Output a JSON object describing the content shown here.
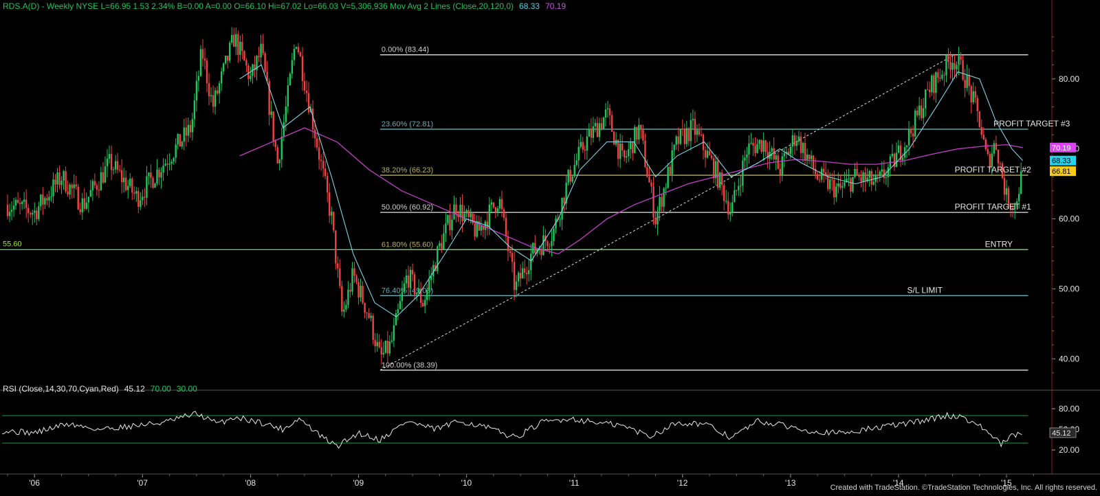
{
  "header": {
    "segments": [
      {
        "text": "RDS.A(D) - Weekly  NYSE  L=66.95  1.53  2.34%  B=0.00  A=0.00  O=66.10  Hi=67.02  Lo=66.03  V=5,306,936  Mov Avg 2 Lines (Close,20,120,0)",
        "color": "#22c55e"
      },
      {
        "text": "68.33",
        "color": "#4fd1e8"
      },
      {
        "text": "70.19",
        "color": "#d946ef"
      }
    ]
  },
  "rsi_header": {
    "segments": [
      {
        "text": "RSI (Close,14,30,70,Cyan,Red)",
        "color": "#e5e5e5"
      },
      {
        "text": "45.12",
        "color": "#e5e5e5"
      },
      {
        "text": "70.00",
        "color": "#22c55e"
      },
      {
        "text": "30.00",
        "color": "#22c55e"
      }
    ]
  },
  "footer": "Created with TradeStation. ©TradeStation Technologies, Inc. All rights reserved.",
  "colors": {
    "up": "#22c55e",
    "down": "#ef4444",
    "ma20": "#7fd6e6",
    "ma120": "#c23fc6",
    "fib": "#d0d0d0",
    "fib236": "#5fb0b8",
    "fib382": "#b8b060",
    "entry": "#4ade80",
    "rsi_line": "#e8e8e8",
    "grid_red": "#8b1a1a"
  },
  "chart_data": {
    "type": "candlestick",
    "title": "RDS.A(D) - Weekly NYSE",
    "x_ticks": [
      "'06",
      "'07",
      "'08",
      "'09",
      "'10",
      "'11",
      "'12",
      "'13",
      "'14",
      "'15"
    ],
    "y_ticks": [
      "80.00",
      "70.00",
      "60.00",
      "50.00",
      "40.00"
    ],
    "y_tick_values": [
      80,
      70,
      60,
      50,
      40
    ],
    "ylim": [
      36.6,
      89.5
    ],
    "price_path": [
      {
        "t": 2005.75,
        "v": 62
      },
      {
        "t": 2006.0,
        "v": 61
      },
      {
        "t": 2006.25,
        "v": 66
      },
      {
        "t": 2006.45,
        "v": 62
      },
      {
        "t": 2006.7,
        "v": 68
      },
      {
        "t": 2006.95,
        "v": 63
      },
      {
        "t": 2007.2,
        "v": 68
      },
      {
        "t": 2007.45,
        "v": 73
      },
      {
        "t": 2007.55,
        "v": 84
      },
      {
        "t": 2007.65,
        "v": 76
      },
      {
        "t": 2007.85,
        "v": 86
      },
      {
        "t": 2008.0,
        "v": 80
      },
      {
        "t": 2008.1,
        "v": 84
      },
      {
        "t": 2008.25,
        "v": 68
      },
      {
        "t": 2008.35,
        "v": 78
      },
      {
        "t": 2008.42,
        "v": 86
      },
      {
        "t": 2008.6,
        "v": 72
      },
      {
        "t": 2008.75,
        "v": 60
      },
      {
        "t": 2008.85,
        "v": 46
      },
      {
        "t": 2008.95,
        "v": 52
      },
      {
        "t": 2009.1,
        "v": 46
      },
      {
        "t": 2009.2,
        "v": 40
      },
      {
        "t": 2009.3,
        "v": 42
      },
      {
        "t": 2009.45,
        "v": 52
      },
      {
        "t": 2009.6,
        "v": 48
      },
      {
        "t": 2009.75,
        "v": 56
      },
      {
        "t": 2009.9,
        "v": 62
      },
      {
        "t": 2010.1,
        "v": 58
      },
      {
        "t": 2010.3,
        "v": 63
      },
      {
        "t": 2010.45,
        "v": 50
      },
      {
        "t": 2010.6,
        "v": 55
      },
      {
        "t": 2010.8,
        "v": 58
      },
      {
        "t": 2010.95,
        "v": 66
      },
      {
        "t": 2011.1,
        "v": 71
      },
      {
        "t": 2011.3,
        "v": 75
      },
      {
        "t": 2011.45,
        "v": 68
      },
      {
        "t": 2011.6,
        "v": 73
      },
      {
        "t": 2011.75,
        "v": 60
      },
      {
        "t": 2011.95,
        "v": 71
      },
      {
        "t": 2012.1,
        "v": 73
      },
      {
        "t": 2012.3,
        "v": 67
      },
      {
        "t": 2012.45,
        "v": 61
      },
      {
        "t": 2012.6,
        "v": 70
      },
      {
        "t": 2012.75,
        "v": 71
      },
      {
        "t": 2012.9,
        "v": 67
      },
      {
        "t": 2013.05,
        "v": 72
      },
      {
        "t": 2013.25,
        "v": 66
      },
      {
        "t": 2013.45,
        "v": 64
      },
      {
        "t": 2013.6,
        "v": 66
      },
      {
        "t": 2013.8,
        "v": 65
      },
      {
        "t": 2013.95,
        "v": 68
      },
      {
        "t": 2014.1,
        "v": 72
      },
      {
        "t": 2014.3,
        "v": 79
      },
      {
        "t": 2014.5,
        "v": 83
      },
      {
        "t": 2014.6,
        "v": 81
      },
      {
        "t": 2014.75,
        "v": 74
      },
      {
        "t": 2014.82,
        "v": 68
      },
      {
        "t": 2014.9,
        "v": 71
      },
      {
        "t": 2015.0,
        "v": 63
      },
      {
        "t": 2015.08,
        "v": 62
      },
      {
        "t": 2015.15,
        "v": 66.95
      }
    ],
    "ma20_path": [
      {
        "t": 2007.9,
        "v": 80
      },
      {
        "t": 2008.1,
        "v": 82
      },
      {
        "t": 2008.3,
        "v": 73
      },
      {
        "t": 2008.55,
        "v": 76
      },
      {
        "t": 2008.75,
        "v": 66
      },
      {
        "t": 2008.95,
        "v": 55
      },
      {
        "t": 2009.15,
        "v": 48
      },
      {
        "t": 2009.35,
        "v": 46
      },
      {
        "t": 2009.55,
        "v": 49
      },
      {
        "t": 2009.8,
        "v": 55
      },
      {
        "t": 2010.0,
        "v": 60
      },
      {
        "t": 2010.2,
        "v": 59
      },
      {
        "t": 2010.4,
        "v": 56
      },
      {
        "t": 2010.6,
        "v": 54
      },
      {
        "t": 2010.85,
        "v": 60
      },
      {
        "t": 2011.05,
        "v": 67
      },
      {
        "t": 2011.3,
        "v": 71
      },
      {
        "t": 2011.55,
        "v": 71
      },
      {
        "t": 2011.75,
        "v": 66
      },
      {
        "t": 2011.95,
        "v": 69
      },
      {
        "t": 2012.2,
        "v": 71
      },
      {
        "t": 2012.45,
        "v": 66
      },
      {
        "t": 2012.7,
        "v": 68
      },
      {
        "t": 2012.9,
        "v": 70
      },
      {
        "t": 2013.1,
        "v": 68
      },
      {
        "t": 2013.35,
        "v": 66
      },
      {
        "t": 2013.6,
        "v": 65
      },
      {
        "t": 2013.85,
        "v": 66
      },
      {
        "t": 2014.1,
        "v": 70
      },
      {
        "t": 2014.35,
        "v": 76
      },
      {
        "t": 2014.55,
        "v": 81
      },
      {
        "t": 2014.75,
        "v": 80
      },
      {
        "t": 2014.9,
        "v": 74
      },
      {
        "t": 2015.05,
        "v": 70
      },
      {
        "t": 2015.15,
        "v": 68.33
      }
    ],
    "ma120_path": [
      {
        "t": 2007.9,
        "v": 69
      },
      {
        "t": 2008.2,
        "v": 71
      },
      {
        "t": 2008.5,
        "v": 73
      },
      {
        "t": 2008.8,
        "v": 71
      },
      {
        "t": 2009.1,
        "v": 67
      },
      {
        "t": 2009.4,
        "v": 64
      },
      {
        "t": 2009.7,
        "v": 62
      },
      {
        "t": 2010.0,
        "v": 60
      },
      {
        "t": 2010.3,
        "v": 58
      },
      {
        "t": 2010.6,
        "v": 56
      },
      {
        "t": 2010.85,
        "v": 55
      },
      {
        "t": 2011.05,
        "v": 57
      },
      {
        "t": 2011.3,
        "v": 60
      },
      {
        "t": 2011.55,
        "v": 62
      },
      {
        "t": 2011.8,
        "v": 63.5
      },
      {
        "t": 2012.05,
        "v": 65
      },
      {
        "t": 2012.3,
        "v": 66
      },
      {
        "t": 2012.55,
        "v": 67
      },
      {
        "t": 2012.8,
        "v": 68
      },
      {
        "t": 2013.05,
        "v": 68.5
      },
      {
        "t": 2013.3,
        "v": 68.2
      },
      {
        "t": 2013.55,
        "v": 67.8
      },
      {
        "t": 2013.8,
        "v": 67.8
      },
      {
        "t": 2014.05,
        "v": 68.3
      },
      {
        "t": 2014.3,
        "v": 69.2
      },
      {
        "t": 2014.55,
        "v": 70
      },
      {
        "t": 2014.8,
        "v": 70.4
      },
      {
        "t": 2015.0,
        "v": 70.6
      },
      {
        "t": 2015.15,
        "v": 70.19
      }
    ],
    "fib_levels": [
      {
        "label": "0.00% (83.44)",
        "value": 83.44,
        "color": "#d0d0d0"
      },
      {
        "label": "23.60% (72.81)",
        "value": 72.81,
        "color": "#5fb0b8"
      },
      {
        "label": "38.20% (66.23)",
        "value": 66.23,
        "color": "#b8b060"
      },
      {
        "label": "50.00% (60.92)",
        "value": 60.92,
        "color": "#d0d0d0"
      },
      {
        "label": "61.80% (55.60)",
        "value": 55.6,
        "color": "#b8b060"
      },
      {
        "label": "76.40% (49.03)",
        "value": 49.03,
        "color": "#5fb0b8"
      },
      {
        "label": "100.00% (38.39)",
        "value": 38.39,
        "color": "#d0d0d0"
      }
    ],
    "fib_range": {
      "from": 2009.2,
      "to": 2015.2
    },
    "trendline": {
      "from": {
        "t": 2009.2,
        "v": 38.39
      },
      "to": {
        "t": 2014.52,
        "v": 83.44
      }
    },
    "entry_line": {
      "label": "55.60",
      "value": 55.6
    },
    "annotations": [
      {
        "text": "PROFIT TARGET #3",
        "t": 2014.88,
        "v": 72.81
      },
      {
        "text": "PROFIT TARGET #2",
        "t": 2014.52,
        "v": 66.23
      },
      {
        "text": "PROFIT TARGET #1",
        "t": 2014.52,
        "v": 60.92
      },
      {
        "text": "ENTRY",
        "t": 2014.8,
        "v": 55.6
      },
      {
        "text": "S/L LIMIT",
        "t": 2014.08,
        "v": 49.03
      }
    ],
    "price_labels": [
      {
        "text": "70.19",
        "value": 70.19,
        "bg": "#d946ef",
        "fg": "#ffffff"
      },
      {
        "text": "68.33",
        "value": 68.33,
        "bg": "#22d3ee",
        "fg": "#000000"
      },
      {
        "text": "66.81",
        "value": 66.81,
        "bg": "#facc15",
        "fg": "#000000"
      }
    ],
    "rsi": {
      "ticks": [
        "80.00",
        "50.00",
        "20.00"
      ],
      "tick_values": [
        80,
        50,
        20
      ],
      "ylim": [
        10,
        95
      ],
      "overbought": 70,
      "oversold": 30,
      "current": "45.12",
      "path": [
        {
          "t": 2005.7,
          "v": 48
        },
        {
          "t": 2006.0,
          "v": 45
        },
        {
          "t": 2006.3,
          "v": 58
        },
        {
          "t": 2006.6,
          "v": 50
        },
        {
          "t": 2006.9,
          "v": 55
        },
        {
          "t": 2007.2,
          "v": 60
        },
        {
          "t": 2007.5,
          "v": 73
        },
        {
          "t": 2007.7,
          "v": 58
        },
        {
          "t": 2007.85,
          "v": 68
        },
        {
          "t": 2008.1,
          "v": 60
        },
        {
          "t": 2008.3,
          "v": 50
        },
        {
          "t": 2008.45,
          "v": 66
        },
        {
          "t": 2008.65,
          "v": 40
        },
        {
          "t": 2008.8,
          "v": 25
        },
        {
          "t": 2009.0,
          "v": 45
        },
        {
          "t": 2009.2,
          "v": 35
        },
        {
          "t": 2009.45,
          "v": 62
        },
        {
          "t": 2009.7,
          "v": 50
        },
        {
          "t": 2009.95,
          "v": 62
        },
        {
          "t": 2010.2,
          "v": 52
        },
        {
          "t": 2010.45,
          "v": 38
        },
        {
          "t": 2010.7,
          "v": 60
        },
        {
          "t": 2010.95,
          "v": 66
        },
        {
          "t": 2011.2,
          "v": 60
        },
        {
          "t": 2011.45,
          "v": 55
        },
        {
          "t": 2011.7,
          "v": 40
        },
        {
          "t": 2011.95,
          "v": 60
        },
        {
          "t": 2012.2,
          "v": 58
        },
        {
          "t": 2012.45,
          "v": 38
        },
        {
          "t": 2012.7,
          "v": 62
        },
        {
          "t": 2012.95,
          "v": 55
        },
        {
          "t": 2013.2,
          "v": 48
        },
        {
          "t": 2013.45,
          "v": 44
        },
        {
          "t": 2013.7,
          "v": 50
        },
        {
          "t": 2013.95,
          "v": 56
        },
        {
          "t": 2014.2,
          "v": 62
        },
        {
          "t": 2014.45,
          "v": 70
        },
        {
          "t": 2014.6,
          "v": 68
        },
        {
          "t": 2014.8,
          "v": 50
        },
        {
          "t": 2014.95,
          "v": 28
        },
        {
          "t": 2015.05,
          "v": 40
        },
        {
          "t": 2015.15,
          "v": 45.12
        }
      ]
    }
  }
}
